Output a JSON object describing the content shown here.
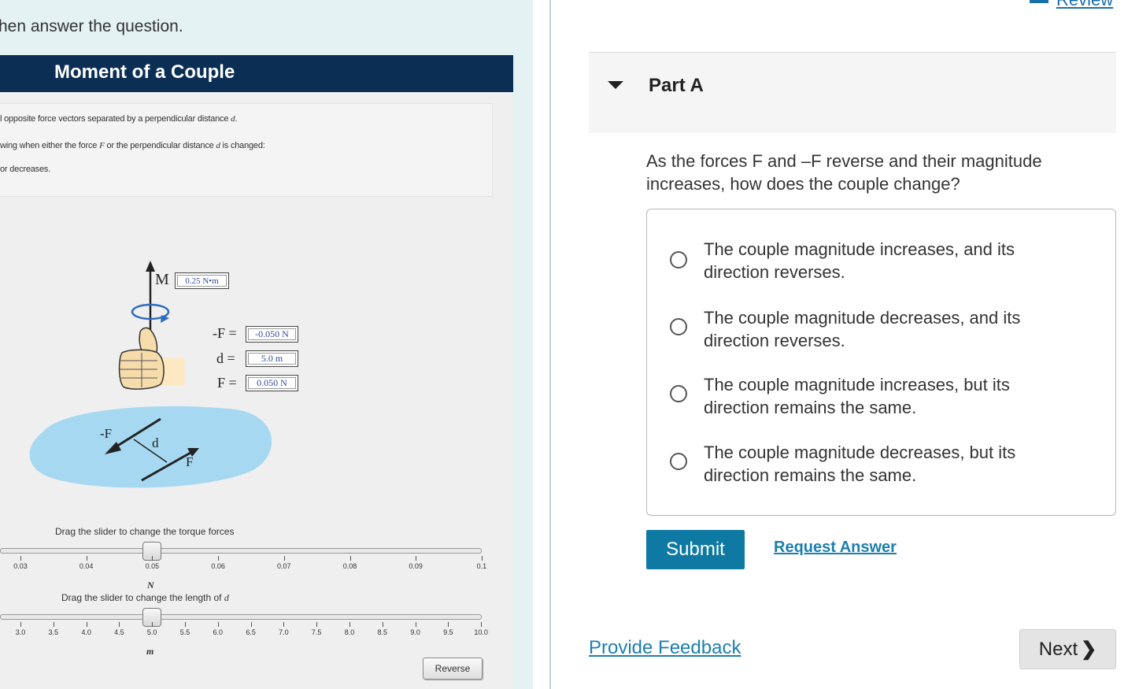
{
  "left": {
    "intro": "hen answer the question.",
    "sim_title": "Moment of a Couple",
    "desc": [
      "l opposite force vectors separated by a perpendicular distance ",
      "wing when either the force ",
      " or the perpendicular distance ",
      " is changed:",
      "or decreases."
    ],
    "desc_vars": {
      "d": "d",
      "F": "F"
    },
    "diagram": {
      "moment_label": "M",
      "moment_value": "0.25 N•m",
      "neg_force_label": "-F =",
      "neg_force_value": "-0.050 N",
      "distance_label": "d =",
      "distance_value": "5.0 m",
      "force_label": "F =",
      "force_value": "0.050 N",
      "plate_neg_force": "-F",
      "plate_distance": "d",
      "plate_force": "F"
    },
    "force_slider": {
      "caption": "Drag the slider to change the torque forces",
      "ticks": [
        "0.03",
        "0.04",
        "0.05",
        "0.06",
        "0.07",
        "0.08",
        "0.09",
        "0.1"
      ],
      "unit": "N",
      "value": 0.05
    },
    "distance_slider": {
      "caption": "Drag the slider to change the length of ",
      "caption_var": "d",
      "ticks": [
        "3.0",
        "3.5",
        "4.0",
        "4.5",
        "5.0",
        "5.5",
        "6.0",
        "6.5",
        "7.0",
        "7.5",
        "8.0",
        "8.5",
        "9.0",
        "9.5",
        "10.0"
      ],
      "unit": "m",
      "value": 5.0
    },
    "reverse_label": "Reverse"
  },
  "right": {
    "review_label": "Review",
    "part_title": "Part A",
    "question": "As the forces F and –F reverse and their magnitude increases, how does the couple change?",
    "options": [
      "The couple magnitude increases, and its direction reverses.",
      "The couple magnitude decreases, and its direction reverses.",
      "The couple magnitude increases, but its direction remains the same.",
      "The couple magnitude decreases, but its direction remains the same."
    ],
    "submit_label": "Submit",
    "request_answer_label": "Request Answer",
    "feedback_label": "Provide Feedback",
    "next_label": "Next"
  },
  "colors": {
    "header_navy": "#0b2e55",
    "submit_teal": "#0e7aa3",
    "link_blue": "#1b7fae",
    "plate_blue": "#a6d9f1"
  }
}
